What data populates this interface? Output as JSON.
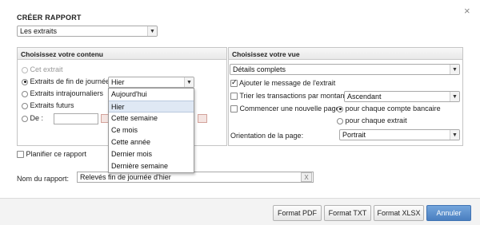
{
  "dialog": {
    "title": "CRÉER RAPPORT",
    "close_glyph": "×",
    "report_type": {
      "value": "Les extraits"
    }
  },
  "content_panel": {
    "header": "Choisissez votre contenu",
    "options": [
      {
        "label": "Cet extrait",
        "checked": false,
        "disabled": true
      },
      {
        "label": "Extraits de fin de journée",
        "checked": true,
        "disabled": false
      },
      {
        "label": "Extraits intrajournaliers",
        "checked": false,
        "disabled": false
      },
      {
        "label": "Extraits futurs",
        "checked": false,
        "disabled": false
      },
      {
        "label": "De :",
        "checked": false,
        "disabled": false
      }
    ],
    "period_select": {
      "value": "Hier"
    },
    "period_options": [
      "Aujourd'hui",
      "Hier",
      "Cette semaine",
      "Ce mois",
      "Cette année",
      "Dernier mois",
      "Dernière semaine"
    ],
    "selected_period": "Hier",
    "schedule_label": "Planifier ce rapport"
  },
  "view_panel": {
    "header": "Choisissez votre vue",
    "view_select": {
      "value": "Détails complets"
    },
    "add_message_label": "Ajouter le message de l'extrait",
    "sort_label": "Trier les transactions par montant",
    "sort_select": {
      "value": "Ascendant"
    },
    "new_page_label": "Commencer une nouvelle page",
    "per_account_label": "pour chaque compte bancaire",
    "per_statement_label": "pour chaque extrait",
    "orientation_label": "Orientation de la page:",
    "orientation_select": {
      "value": "Portrait"
    }
  },
  "report_name": {
    "label": "Nom du rapport:",
    "value": "Relevés fin de journée d'hier",
    "clear_glyph": "X"
  },
  "footer": {
    "buttons": {
      "pdf": "Format PDF",
      "txt": "Format TXT",
      "xlsx": "Format XLSX",
      "cancel": "Annuler"
    }
  },
  "colors": {
    "primary_button": "#4a7fc0",
    "selected_item": "#dfe8f4"
  }
}
